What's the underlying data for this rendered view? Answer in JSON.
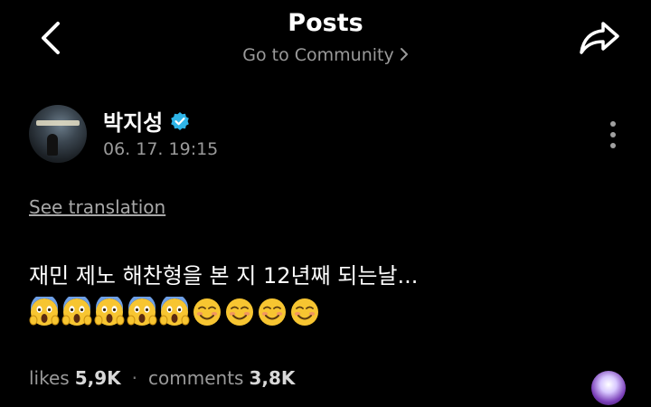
{
  "header": {
    "title": "Posts",
    "community_link": "Go to Community"
  },
  "post": {
    "author": "박지성",
    "verified": true,
    "timestamp": "06. 17. 19:15",
    "see_translation": "See translation",
    "text": "재민 제노 해찬형을 본 지 12년째 되는날...",
    "emojis": [
      "face-screaming-in-fear",
      "face-screaming-in-fear",
      "face-screaming-in-fear",
      "face-screaming-in-fear",
      "face-screaming-in-fear",
      "smiling-face",
      "smiling-face",
      "smiling-face",
      "smiling-face"
    ]
  },
  "stats": {
    "likes_label": "likes",
    "likes_value": "5,9K",
    "separator": "·",
    "comments_label": "comments",
    "comments_value": "3,8K"
  },
  "colors": {
    "background": "#000000",
    "text_primary": "#ffffff",
    "text_secondary": "#9a9a9a",
    "verified_badge": "#2fb5e8",
    "emoji_yellow": "#f7c531"
  },
  "icons": {
    "back": "chevron-left-icon",
    "share": "share-arrow-icon",
    "more": "more-vertical-icon",
    "verified": "verified-badge-icon"
  }
}
